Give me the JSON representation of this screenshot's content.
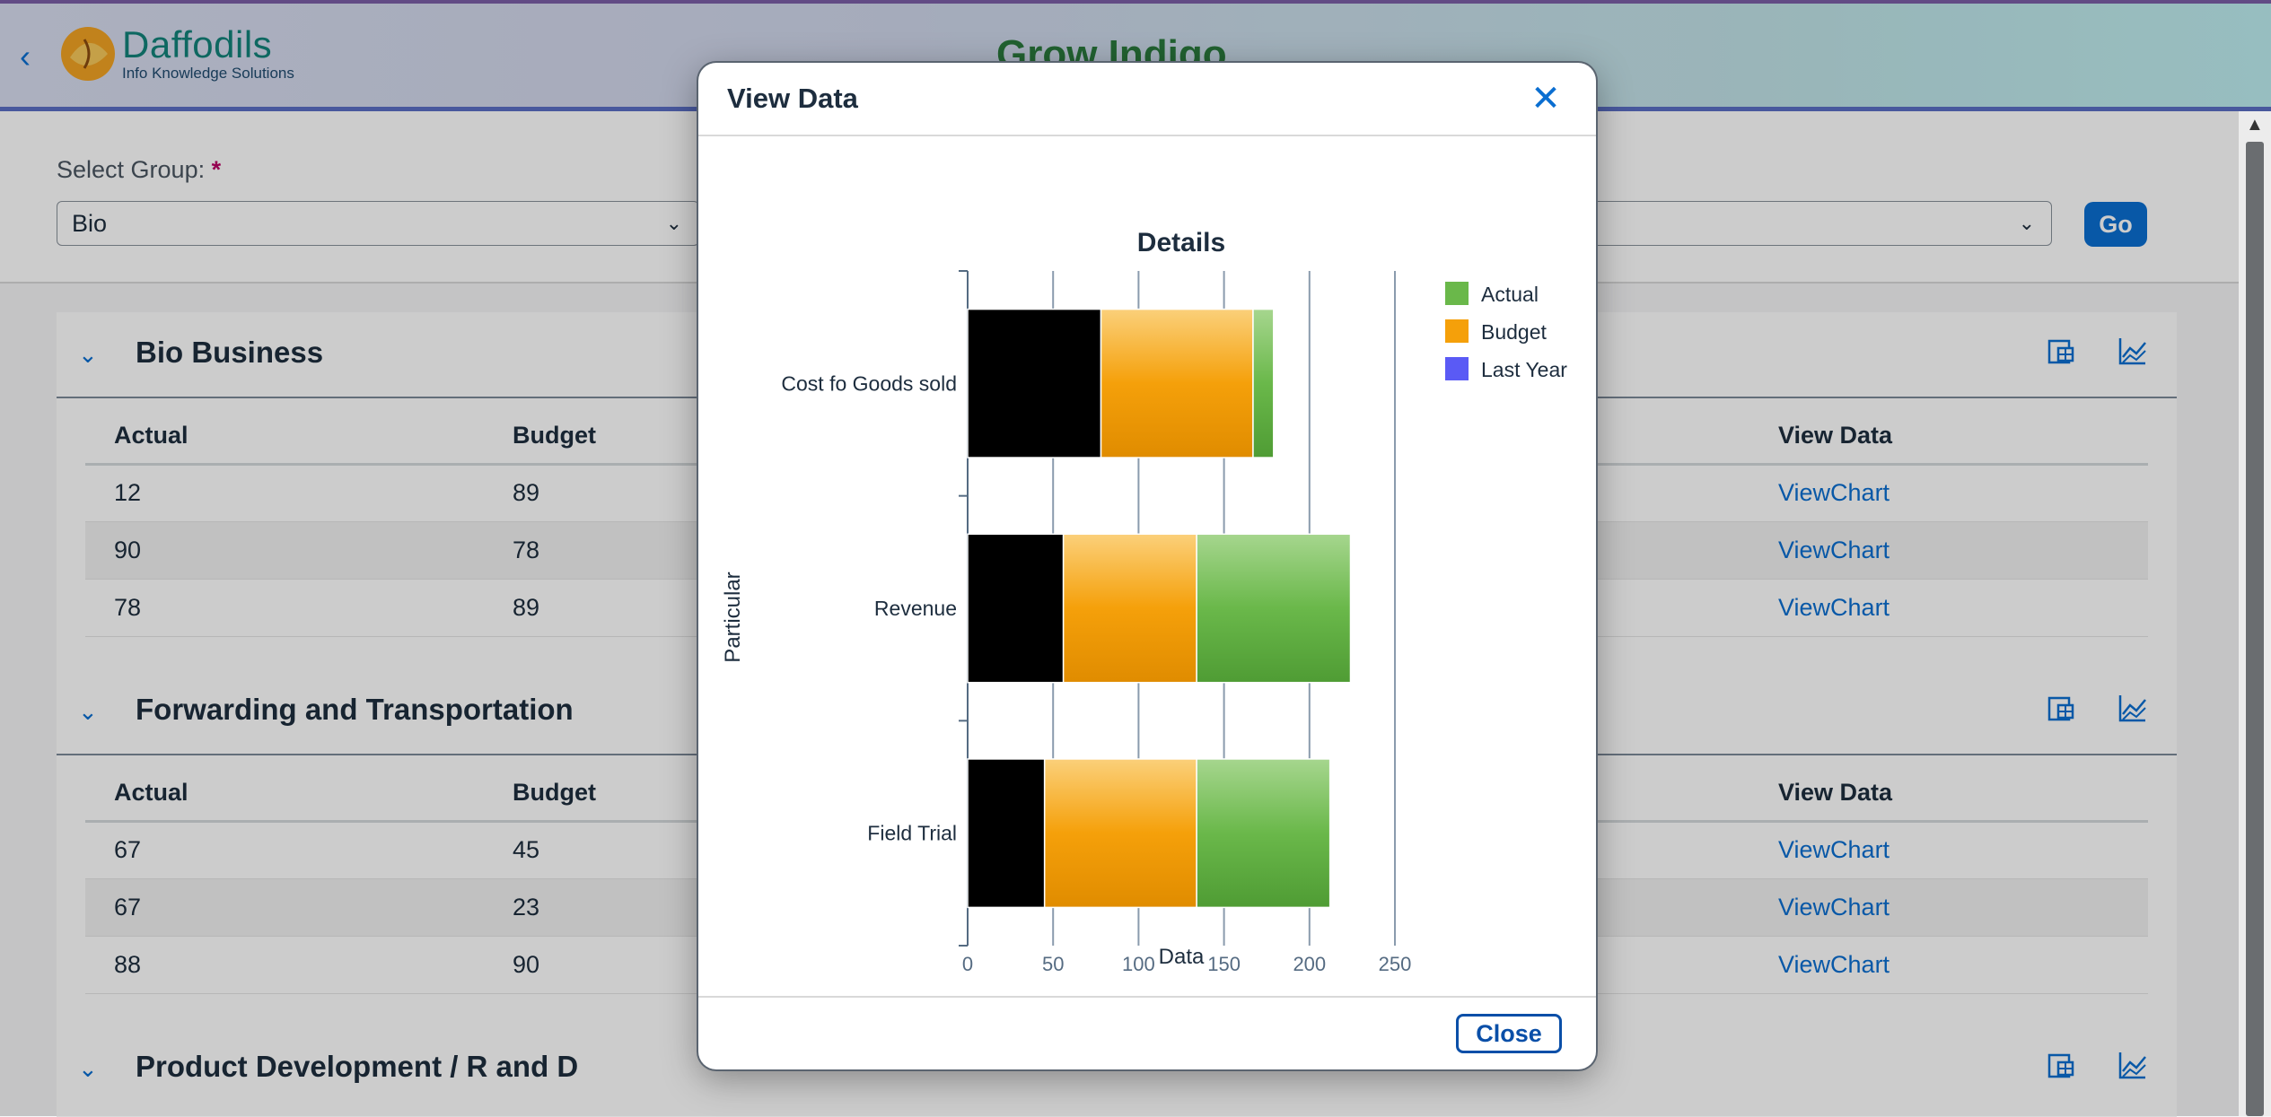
{
  "header": {
    "back_icon": "chevron-left-icon",
    "logo_title": "Daffodils",
    "logo_subtitle": "Info Knowledge Solutions",
    "app_title": "Grow Indigo"
  },
  "filters": {
    "group_label": "Select Group:",
    "required_mark": "*",
    "group_value": "Bio",
    "second_value": "",
    "go_label": "Go"
  },
  "panels": [
    {
      "title": "Bio Business",
      "columns": [
        "Actual",
        "Budget",
        "View Data"
      ],
      "rows": [
        {
          "actual": "12",
          "budget": "89",
          "link": "ViewChart"
        },
        {
          "actual": "90",
          "budget": "78",
          "link": "ViewChart"
        },
        {
          "actual": "78",
          "budget": "89",
          "link": "ViewChart"
        }
      ]
    },
    {
      "title": "Forwarding and Transportation",
      "columns": [
        "Actual",
        "Budget",
        "View Data"
      ],
      "rows": [
        {
          "actual": "67",
          "budget": "45",
          "link": "ViewChart"
        },
        {
          "actual": "67",
          "budget": "23",
          "link": "ViewChart"
        },
        {
          "actual": "88",
          "budget": "90",
          "link": "ViewChart"
        }
      ]
    },
    {
      "title": "Product Development / R and D"
    }
  ],
  "dialog": {
    "title": "View Data",
    "close_label": "Close"
  },
  "chart_data": {
    "type": "bar",
    "orientation": "horizontal",
    "stacked": true,
    "title": "Details",
    "xlabel": "Data",
    "ylabel": "Particular",
    "categories": [
      "Cost fo Goods sold",
      "Revenue",
      "Field Trial"
    ],
    "series": [
      {
        "name": "Last Year",
        "color": "#5a5af5",
        "values": [
          78,
          56,
          45
        ]
      },
      {
        "name": "Budget",
        "color": "#f5a00a",
        "values": [
          89,
          78,
          89
        ]
      },
      {
        "name": "Actual",
        "color": "#6ab84a",
        "values": [
          12,
          90,
          78
        ]
      }
    ],
    "legend_order": [
      "Actual",
      "Budget",
      "Last Year"
    ],
    "xlim": [
      0,
      250
    ],
    "xticks": [
      "0",
      "50",
      "100",
      "150",
      "200",
      "250"
    ],
    "grid": true,
    "legend_position": "top-right"
  }
}
